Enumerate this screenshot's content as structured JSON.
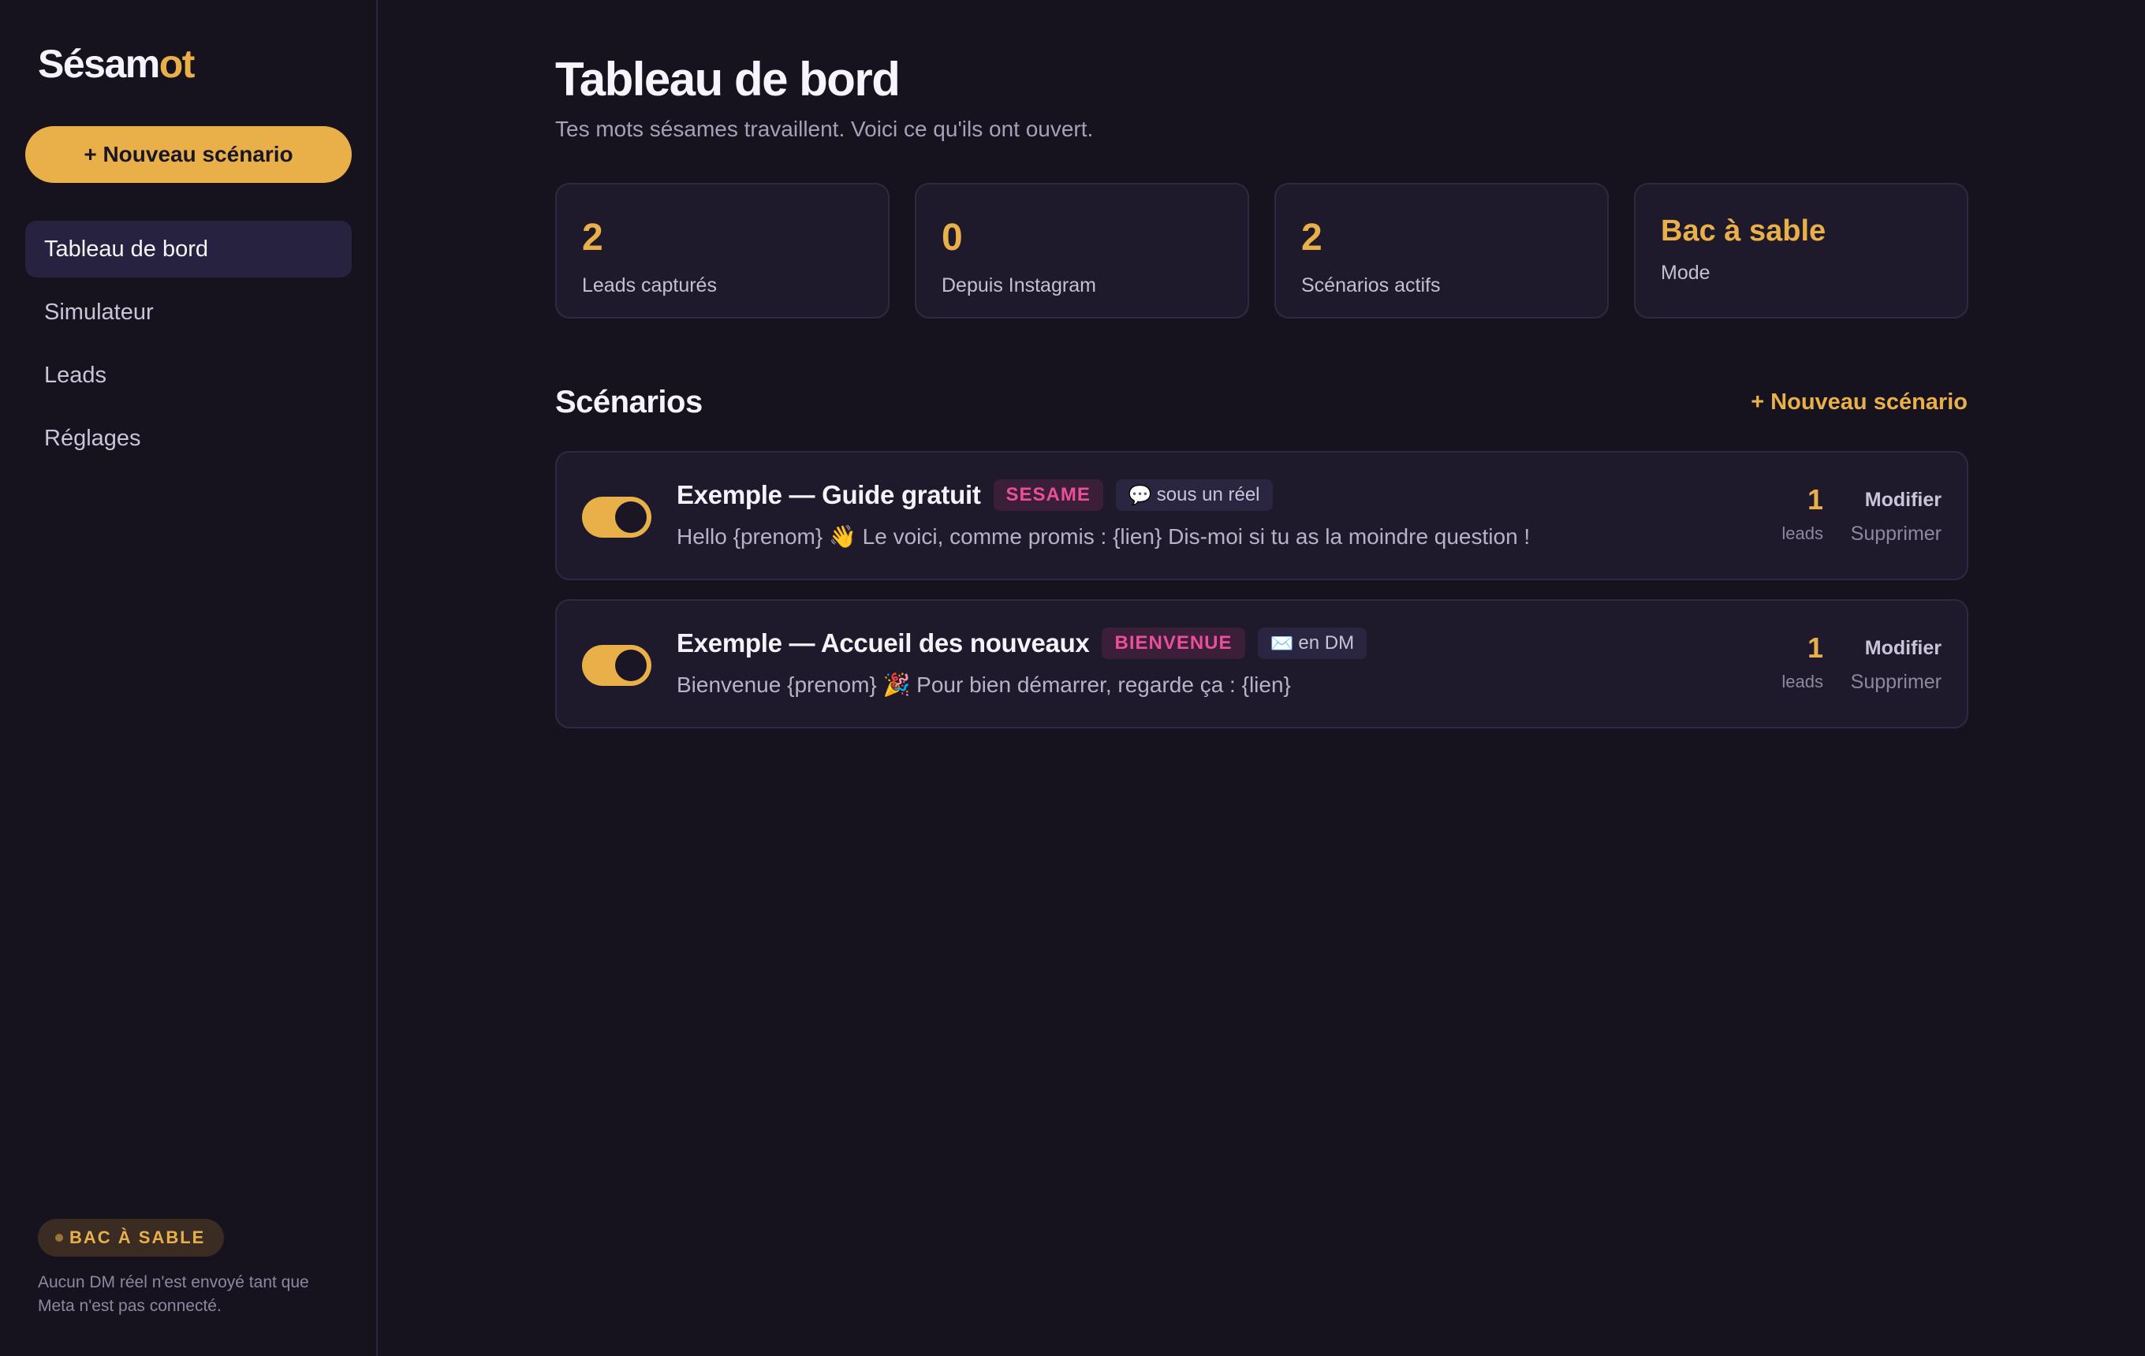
{
  "brand": {
    "name_main": "Sésam",
    "name_accent": "ot",
    "accent_color": "#e9b04a"
  },
  "sidebar": {
    "new_button": "+ Nouveau scénario",
    "items": [
      {
        "label": "Tableau de bord",
        "active": true
      },
      {
        "label": "Simulateur",
        "active": false
      },
      {
        "label": "Leads",
        "active": false
      },
      {
        "label": "Réglages",
        "active": false
      }
    ],
    "sandbox_badge": "BAC À SABLE",
    "sandbox_note": "Aucun DM réel n'est envoyé tant que Meta n'est pas connecté."
  },
  "page": {
    "title": "Tableau de bord",
    "subtitle": "Tes mots sésames travaillent. Voici ce qu'ils ont ouvert."
  },
  "stats": [
    {
      "value": "2",
      "label": "Leads capturés"
    },
    {
      "value": "0",
      "label": "Depuis Instagram"
    },
    {
      "value": "2",
      "label": "Scénarios actifs"
    },
    {
      "value": "Bac à sable",
      "label": "Mode"
    }
  ],
  "scenarios_section": {
    "title": "Scénarios",
    "new_link": "+ Nouveau scénario",
    "items": [
      {
        "enabled": true,
        "title": "Exemple — Guide gratuit",
        "keyword": "SESAME",
        "trigger_icon": "speech-bubble-icon",
        "trigger_emoji": "💬",
        "trigger": "sous un réel",
        "message": "Hello {prenom} 👋 Le voici, comme promis : {lien} Dis-moi si tu as la moindre question !",
        "leads_count": "1",
        "leads_label": "leads",
        "edit_label": "Modifier",
        "delete_label": "Supprimer"
      },
      {
        "enabled": true,
        "title": "Exemple — Accueil des nouveaux",
        "keyword": "BIENVENUE",
        "trigger_icon": "envelope-icon",
        "trigger_emoji": "✉️",
        "trigger": "en DM",
        "message": "Bienvenue {prenom} 🎉 Pour bien démarrer, regarde ça : {lien}",
        "leads_count": "1",
        "leads_label": "leads",
        "edit_label": "Modifier",
        "delete_label": "Supprimer"
      }
    ]
  }
}
